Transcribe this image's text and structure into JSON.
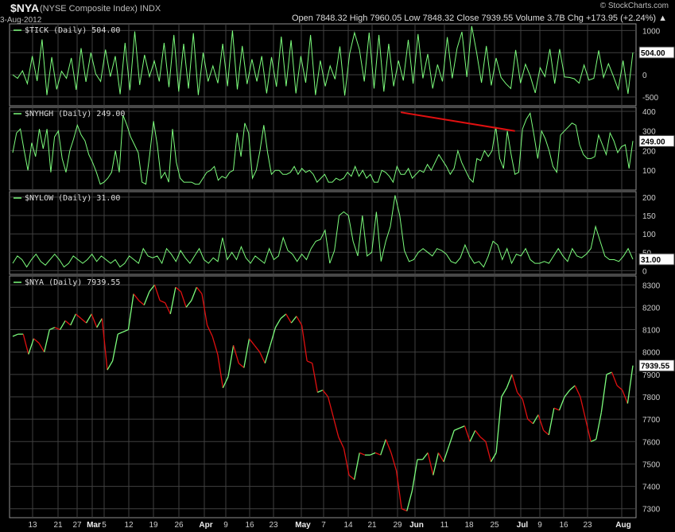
{
  "header": {
    "symbol": "$NYA",
    "name": "(NYSE Composite Index) INDX",
    "date": "3-Aug-2012",
    "brand": "© StockCharts.com",
    "quote": "Open 7848.32  High 7960.05  Low 7848.32  Close 7939.55  Volume 3.7B  Chg +173.95 (+2.24%) ▲"
  },
  "colors": {
    "background": "#000000",
    "grid": "#404040",
    "up": "#7CFC7C",
    "down": "#E01010",
    "frame": "#909090",
    "text": "#cccccc"
  },
  "chart_data": [
    {
      "type": "line",
      "legend": "$TICK (Daily) 504.00",
      "ylim": [
        -700,
        1150
      ],
      "yticks": [
        1000,
        500,
        0,
        -500
      ],
      "ytick_labels": [
        "1000",
        "500",
        "0",
        "-500"
      ],
      "last_value_label": "504.00",
      "values": [
        0,
        -80,
        90,
        -200,
        420,
        -140,
        800,
        -460,
        400,
        -330,
        80,
        -80,
        380,
        -340,
        600,
        -160,
        500,
        20,
        -150,
        570,
        -40,
        420,
        -440,
        720,
        -350,
        980,
        -230,
        450,
        -40,
        310,
        -150,
        720,
        -280,
        900,
        -380,
        700,
        -310,
        940,
        -460,
        500,
        -150,
        200,
        -190,
        700,
        -260,
        1000,
        -330,
        650,
        -210,
        350,
        -150,
        420,
        -420,
        400,
        -270,
        860,
        -260,
        780,
        -420,
        420,
        -180,
        900,
        -460,
        320,
        -260,
        200,
        -100,
        640,
        -470,
        480,
        950,
        570,
        -150,
        950,
        -310,
        900,
        -380,
        700,
        -260,
        320,
        -130,
        790,
        -200,
        920,
        -80,
        470,
        -310,
        230,
        -150,
        850,
        -80,
        600,
        970,
        -50,
        1100,
        500,
        -180,
        650,
        -240,
        380,
        -60,
        -200,
        -310,
        560,
        -190,
        240,
        -30,
        -410,
        160,
        -40,
        580,
        -200,
        580,
        -50,
        -60,
        -90,
        -190,
        220,
        -120,
        -80,
        550,
        -60,
        250,
        -30,
        -330,
        320,
        -430,
        504
      ]
    },
    {
      "type": "line",
      "legend": "$NYHGH (Daily) 249.00",
      "ylim": [
        0,
        420
      ],
      "yticks": [
        400,
        300,
        200,
        100
      ],
      "ytick_labels": [
        "400",
        "300",
        "200",
        "100"
      ],
      "last_value_label": "249.00",
      "trendline": {
        "from": [
          102,
          395
        ],
        "to": [
          132,
          300
        ]
      },
      "values": [
        190,
        290,
        310,
        200,
        100,
        240,
        170,
        310,
        210,
        310,
        90,
        270,
        300,
        160,
        90,
        200,
        260,
        330,
        280,
        250,
        180,
        140,
        90,
        30,
        40,
        60,
        90,
        200,
        90,
        380,
        330,
        270,
        230,
        190,
        40,
        30,
        180,
        350,
        230,
        60,
        90,
        40,
        310,
        140,
        60,
        40,
        40,
        40,
        30,
        30,
        60,
        90,
        100,
        120,
        50,
        70,
        60,
        90,
        100,
        290,
        170,
        340,
        290,
        60,
        100,
        200,
        330,
        190,
        80,
        100,
        100,
        80,
        80,
        90,
        120,
        80,
        110,
        90,
        100,
        80,
        40,
        60,
        80,
        40,
        40,
        60,
        50,
        60,
        90,
        70,
        120,
        70,
        100,
        60,
        80,
        40,
        40,
        100,
        90,
        70,
        40,
        120,
        80,
        80,
        110,
        60,
        80,
        100,
        90,
        130,
        100,
        140,
        180,
        150,
        120,
        80,
        110,
        200,
        140,
        100,
        60,
        40,
        160,
        150,
        200,
        170,
        200,
        320,
        160,
        110,
        300,
        180,
        80,
        90,
        310,
        360,
        390,
        280,
        160,
        300,
        260,
        200,
        120,
        90,
        280,
        300,
        320,
        340,
        330,
        230,
        180,
        160,
        160,
        170,
        280,
        230,
        180,
        290,
        250,
        190,
        220,
        230,
        110,
        249
      ]
    },
    {
      "type": "line",
      "legend": "$NYLOW (Daily) 31.00",
      "ylim": [
        -10,
        215
      ],
      "yticks": [
        200,
        150,
        100,
        50,
        0
      ],
      "ytick_labels": [
        "200",
        "150",
        "100",
        "50",
        "0"
      ],
      "last_value_label": "31.00",
      "values": [
        20,
        40,
        30,
        10,
        30,
        45,
        25,
        15,
        30,
        45,
        30,
        10,
        20,
        40,
        30,
        20,
        30,
        45,
        25,
        40,
        30,
        20,
        30,
        10,
        20,
        40,
        30,
        20,
        60,
        40,
        35,
        40,
        20,
        60,
        45,
        25,
        55,
        35,
        20,
        40,
        60,
        30,
        20,
        35,
        25,
        90,
        30,
        50,
        30,
        65,
        35,
        20,
        40,
        30,
        20,
        60,
        30,
        40,
        90,
        55,
        45,
        25,
        45,
        30,
        60,
        80,
        85,
        110,
        20,
        55,
        150,
        160,
        150,
        80,
        40,
        150,
        40,
        50,
        160,
        25,
        80,
        120,
        205,
        150,
        55,
        25,
        30,
        50,
        60,
        50,
        40,
        60,
        55,
        45,
        25,
        20,
        35,
        70,
        40,
        20,
        25,
        10,
        40,
        80,
        70,
        30,
        60,
        20,
        45,
        40,
        60,
        30,
        20,
        20,
        25,
        20,
        40,
        60,
        40,
        25,
        60,
        40,
        35,
        45,
        60,
        120,
        80,
        40,
        30,
        30,
        25,
        40,
        60,
        31
      ]
    },
    {
      "type": "line",
      "legend": "$NYA (Daily) 7939.55",
      "ylim": [
        7260,
        8340
      ],
      "yticks": [
        8300,
        8200,
        8100,
        8000,
        7900,
        7800,
        7700,
        7600,
        7500,
        7400,
        7300
      ],
      "ytick_labels": [
        "8300",
        "8200",
        "8100",
        "8000",
        "7900",
        "7800",
        "7700",
        "7600",
        "7500",
        "7400",
        "7300"
      ],
      "last_value_label": "7939.55",
      "xtick_labels": [
        "13",
        "21",
        "27",
        "Mar",
        "5",
        "12",
        "19",
        "26",
        "Apr",
        "9",
        "16",
        "23",
        "May",
        "7",
        "14",
        "21",
        "29",
        "Jun",
        "11",
        "18",
        "25",
        "Jul",
        "9",
        "16",
        "23",
        "Aug"
      ],
      "values": [
        8070,
        8080,
        8080,
        7990,
        8060,
        8040,
        8000,
        8100,
        8110,
        8100,
        8140,
        8120,
        8170,
        8150,
        8130,
        8170,
        8110,
        8150,
        7920,
        7960,
        8080,
        8090,
        8100,
        8260,
        8230,
        8210,
        8270,
        8300,
        8230,
        8220,
        8170,
        8290,
        8270,
        8200,
        8230,
        8290,
        8260,
        8120,
        8070,
        7990,
        7840,
        7890,
        8030,
        7950,
        7930,
        8060,
        8030,
        8000,
        7950,
        8030,
        8110,
        8150,
        8170,
        8130,
        8160,
        8120,
        7960,
        7950,
        7820,
        7830,
        7800,
        7710,
        7620,
        7570,
        7450,
        7430,
        7550,
        7540,
        7540,
        7550,
        7540,
        7610,
        7550,
        7470,
        7300,
        7290,
        7380,
        7520,
        7520,
        7550,
        7450,
        7550,
        7510,
        7580,
        7650,
        7660,
        7670,
        7600,
        7650,
        7620,
        7600,
        7510,
        7550,
        7800,
        7840,
        7900,
        7820,
        7790,
        7700,
        7680,
        7720,
        7650,
        7630,
        7750,
        7740,
        7800,
        7830,
        7850,
        7800,
        7700,
        7600,
        7610,
        7730,
        7900,
        7910,
        7850,
        7830,
        7770,
        7939.55
      ]
    }
  ]
}
